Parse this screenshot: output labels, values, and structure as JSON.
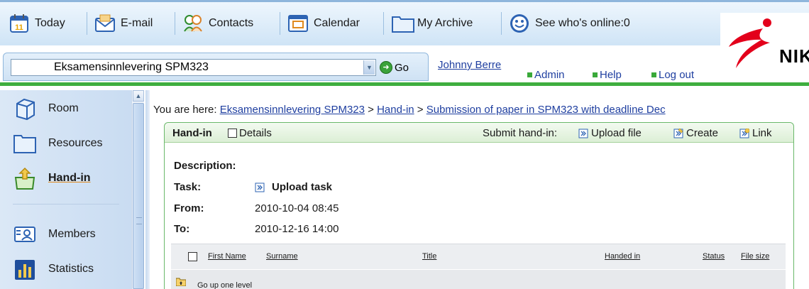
{
  "toolbar": {
    "items": [
      {
        "label": "Today",
        "icon": "calendar-day-icon"
      },
      {
        "label": "E-mail",
        "icon": "envelope-icon"
      },
      {
        "label": "Contacts",
        "icon": "contacts-people-icon"
      },
      {
        "label": "Calendar",
        "icon": "calendar-window-icon"
      },
      {
        "label": "My Archive",
        "icon": "folder-icon"
      },
      {
        "label": "See who's online:0",
        "icon": "smiley-online-icon"
      }
    ],
    "today_badge": "11"
  },
  "logo": {
    "text": "NIK",
    "color": "#e3001b"
  },
  "room_bar": {
    "selected_course": "Eksamensinnlevering SPM323",
    "go_label": "Go",
    "user_name": "Johnny Berre",
    "links": [
      "Admin",
      "Help",
      "Log out"
    ]
  },
  "sidebar": {
    "items": [
      {
        "label": "Room",
        "icon": "room-cube-icon"
      },
      {
        "label": "Resources",
        "icon": "folder-icon"
      },
      {
        "label": "Hand-in",
        "icon": "hand-in-tray-icon",
        "active": true
      },
      {
        "label": "Members",
        "icon": "members-card-icon"
      },
      {
        "label": "Statistics",
        "icon": "bar-chart-icon"
      }
    ]
  },
  "breadcrumb": {
    "prefix": "You are here:",
    "parts": [
      "Eksamensinnlevering SPM323",
      "Hand-in",
      "Submission of paper in SPM323 with deadline Dec"
    ],
    "separator": ">"
  },
  "panel": {
    "title": "Hand-in",
    "details_label": "Details",
    "submit_label": "Submit hand-in:",
    "submit_actions": [
      {
        "label": "Upload file",
        "icon": "upload-icon"
      },
      {
        "label": "Create",
        "icon": "create-icon"
      },
      {
        "label": "Link",
        "icon": "link-icon"
      }
    ],
    "description_label": "Description:",
    "task_label": "Task:",
    "task_value": "Upload task",
    "from_label": "From:",
    "from_value": "2010-10-04 08:45",
    "to_label": "To:",
    "to_value": "2010-12-16 14:00"
  },
  "table": {
    "columns": [
      "First Name",
      "Surname",
      "Title",
      "Handed in",
      "Status",
      "File size"
    ],
    "rows": [
      {
        "label": "Go up one level",
        "icon": "folder-up-icon"
      }
    ]
  },
  "colors": {
    "accent_green": "#3fae3f",
    "link_blue": "#1f3fa0",
    "toolbar_blue": "#cfe4f6"
  }
}
